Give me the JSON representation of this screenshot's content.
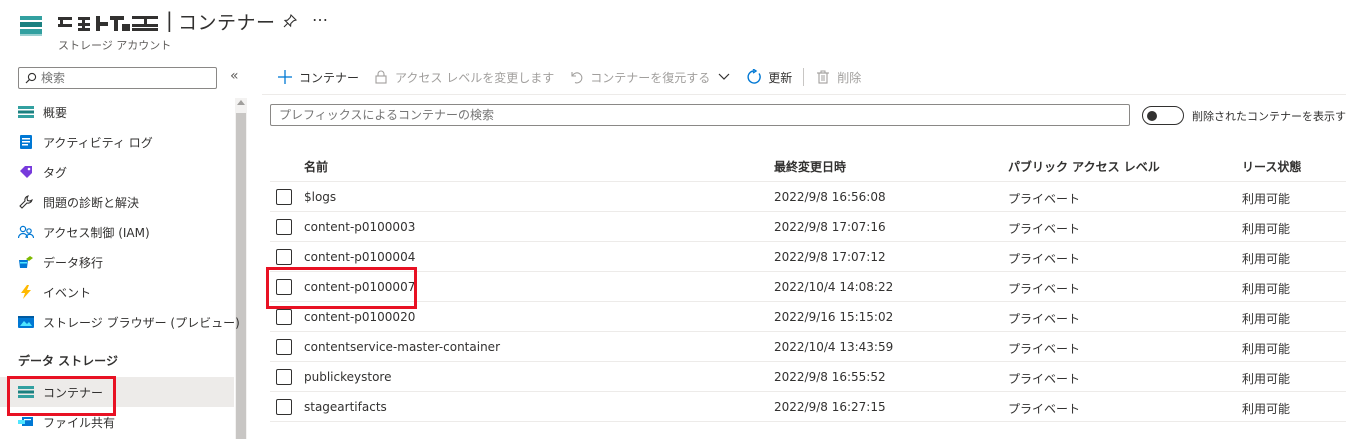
{
  "header": {
    "page_title": "コンテナー",
    "title_separator": "|",
    "resource_type": "ストレージ アカウント",
    "more_label": "…"
  },
  "sidebar": {
    "search_placeholder": "検索",
    "collapse_label": "«",
    "items": [
      {
        "label": "概要",
        "icon": "overview-icon"
      },
      {
        "label": "アクティビティ ログ",
        "icon": "activity-log-icon"
      },
      {
        "label": "タグ",
        "icon": "tag-icon"
      },
      {
        "label": "問題の診断と解決",
        "icon": "wrench-icon"
      },
      {
        "label": "アクセス制御 (IAM)",
        "icon": "people-icon"
      },
      {
        "label": "データ移行",
        "icon": "data-migration-icon"
      },
      {
        "label": "イベント",
        "icon": "lightning-icon"
      },
      {
        "label": "ストレージ ブラウザー (プレビュー)",
        "icon": "storage-browser-icon"
      }
    ],
    "section_title": "データ ストレージ",
    "storage_items": [
      {
        "label": "コンテナー",
        "icon": "container-icon"
      },
      {
        "label": "ファイル共有",
        "icon": "file-share-icon"
      }
    ]
  },
  "toolbar": {
    "add_container": "コンテナー",
    "change_access_level": "アクセス レベルを変更します",
    "restore_container": "コンテナーを復元する",
    "refresh": "更新",
    "delete": "削除"
  },
  "filter": {
    "placeholder": "プレフィックスによるコンテナーの検索",
    "toggle_label": "削除されたコンテナーを表示する",
    "toggle_on": false
  },
  "table": {
    "columns": [
      "名前",
      "最終変更日時",
      "パブリック アクセス レベル",
      "リース状態"
    ],
    "rows": [
      {
        "name": "$logs",
        "modified": "2022/9/8 16:56:08",
        "access": "プライベート",
        "lease": "利用可能"
      },
      {
        "name": "content-p0100003",
        "modified": "2022/9/8 17:07:16",
        "access": "プライベート",
        "lease": "利用可能"
      },
      {
        "name": "content-p0100004",
        "modified": "2022/9/8 17:07:12",
        "access": "プライベート",
        "lease": "利用可能"
      },
      {
        "name": "content-p0100007",
        "modified": "2022/10/4 14:08:22",
        "access": "プライベート",
        "lease": "利用可能"
      },
      {
        "name": "content-p0100020",
        "modified": "2022/9/16 15:15:02",
        "access": "プライベート",
        "lease": "利用可能"
      },
      {
        "name": "contentservice-master-container",
        "modified": "2022/10/4 13:43:59",
        "access": "プライベート",
        "lease": "利用可能"
      },
      {
        "name": "publickeystore",
        "modified": "2022/9/8 16:55:52",
        "access": "プライベート",
        "lease": "利用可能"
      },
      {
        "name": "stageartifacts",
        "modified": "2022/9/8 16:27:15",
        "access": "プライベート",
        "lease": "利用可能"
      }
    ]
  },
  "colors": {
    "accent": "#0078d4",
    "highlight": "#e81123",
    "selected_bg": "#edebe9"
  }
}
